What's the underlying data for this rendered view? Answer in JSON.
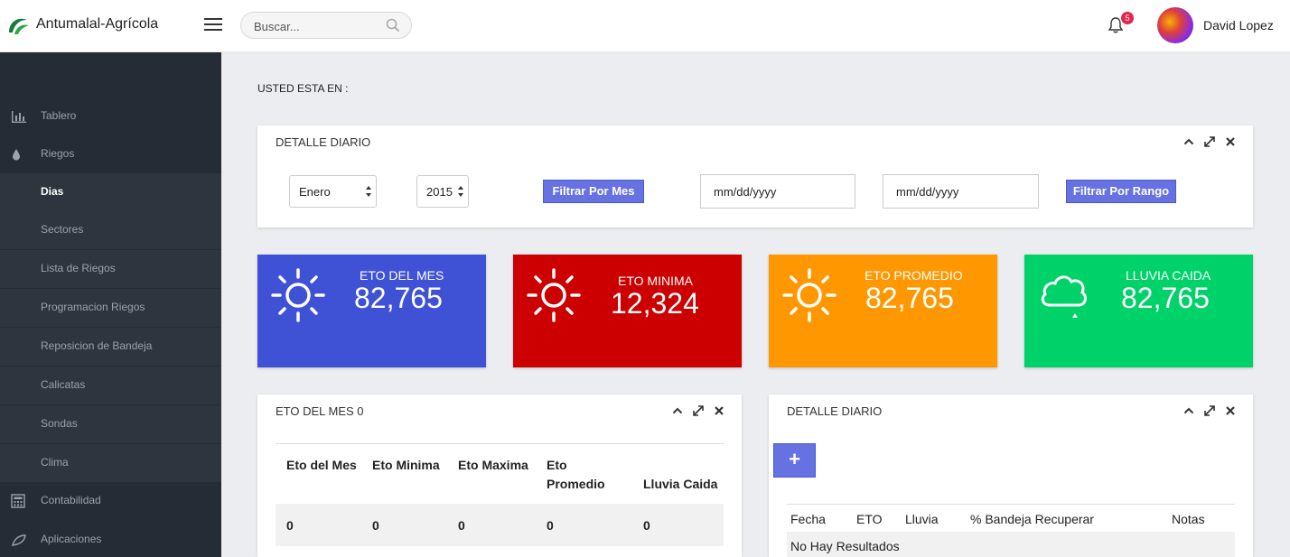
{
  "header": {
    "brand": "Antumalal-Agrícola",
    "search_placeholder": "Buscar...",
    "notification_count": "5",
    "username": "David Lopez"
  },
  "sidebar": {
    "items": [
      {
        "label": "Tablero",
        "icon": "bar-chart-icon"
      },
      {
        "label": "Riegos",
        "icon": "droplet-icon"
      },
      {
        "label": "Dias"
      },
      {
        "label": "Sectores"
      },
      {
        "label": "Lista de Riegos"
      },
      {
        "label": "Programacion Riegos"
      },
      {
        "label": "Reposicion de Bandeja"
      },
      {
        "label": "Calicatas"
      },
      {
        "label": "Sondas"
      },
      {
        "label": "Clima"
      },
      {
        "label": "Contabilidad",
        "icon": "calculator-icon"
      },
      {
        "label": "Aplicaciones",
        "icon": "leaf-icon"
      }
    ]
  },
  "breadcrumb": "USTED ESTA EN :",
  "filter_panel": {
    "title": "DETALLE DIARIO",
    "month": "Enero",
    "year": "2015",
    "filter_month_button": "Filtrar Por Mes",
    "date_from": "mm/dd/yyyy",
    "date_to": "mm/dd/yyyy",
    "filter_range_button": "Filtrar Por Rango"
  },
  "stats": [
    {
      "title": "ETO DEL MES",
      "value": "82,765",
      "color": "#3f51d5",
      "icon": "sun-icon"
    },
    {
      "title": "ETO MINIMA",
      "value": "12,324",
      "color": "#cc0000",
      "icon": "sun-icon"
    },
    {
      "title": "ETO PROMEDIO",
      "value": "82,765",
      "color": "#ff9800",
      "icon": "sun-icon"
    },
    {
      "title": "LLUVIA CAIDA",
      "value": "82,765",
      "color": "#00d26a",
      "icon": "cloud-rain-icon"
    }
  ],
  "eto_panel": {
    "title": "ETO DEL MES 0",
    "columns": [
      "Eto del Mes",
      "Eto Minima",
      "Eto Maxima",
      "Eto Promedio",
      "Lluvia Caida"
    ],
    "row": [
      "0",
      "0",
      "0",
      "0",
      "0"
    ]
  },
  "daily_panel": {
    "title": "DETALLE DIARIO",
    "add_label": "+",
    "columns": [
      "Fecha",
      "ETO",
      "Lluvia",
      "% Bandeja Recuperar",
      "Notas"
    ],
    "empty": "No Hay Resultados"
  }
}
